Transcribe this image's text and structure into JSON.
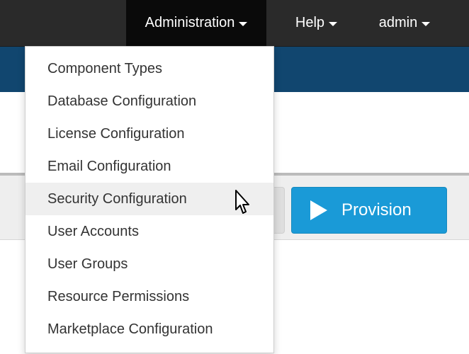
{
  "topbar": {
    "items": [
      {
        "label": "Administration",
        "active": true,
        "icon": "chevron-down-icon"
      },
      {
        "label": "Help",
        "active": false,
        "icon": "chevron-down-icon"
      },
      {
        "label": "admin",
        "active": false,
        "icon": "chevron-down-icon"
      }
    ]
  },
  "dropdown": {
    "items": [
      {
        "label": "Component Types"
      },
      {
        "label": "Database Configuration"
      },
      {
        "label": "License Configuration"
      },
      {
        "label": "Email Configuration"
      },
      {
        "label": "Security Configuration",
        "highlighted": true
      },
      {
        "label": "User Accounts"
      },
      {
        "label": "User Groups"
      },
      {
        "label": "Resource Permissions"
      },
      {
        "label": "Marketplace Configuration"
      }
    ]
  },
  "toolbar": {
    "provision_label": "Provision"
  },
  "colors": {
    "topbar": "#2a2a2a",
    "active_nav": "#0a0a0a",
    "blue_band": "#11466f",
    "primary_button": "#1a9ad7",
    "menu_highlight": "#efefef"
  },
  "icons": {
    "caret": "chevron-down-icon",
    "play": "play-icon",
    "cursor": "mouse-pointer-icon"
  }
}
